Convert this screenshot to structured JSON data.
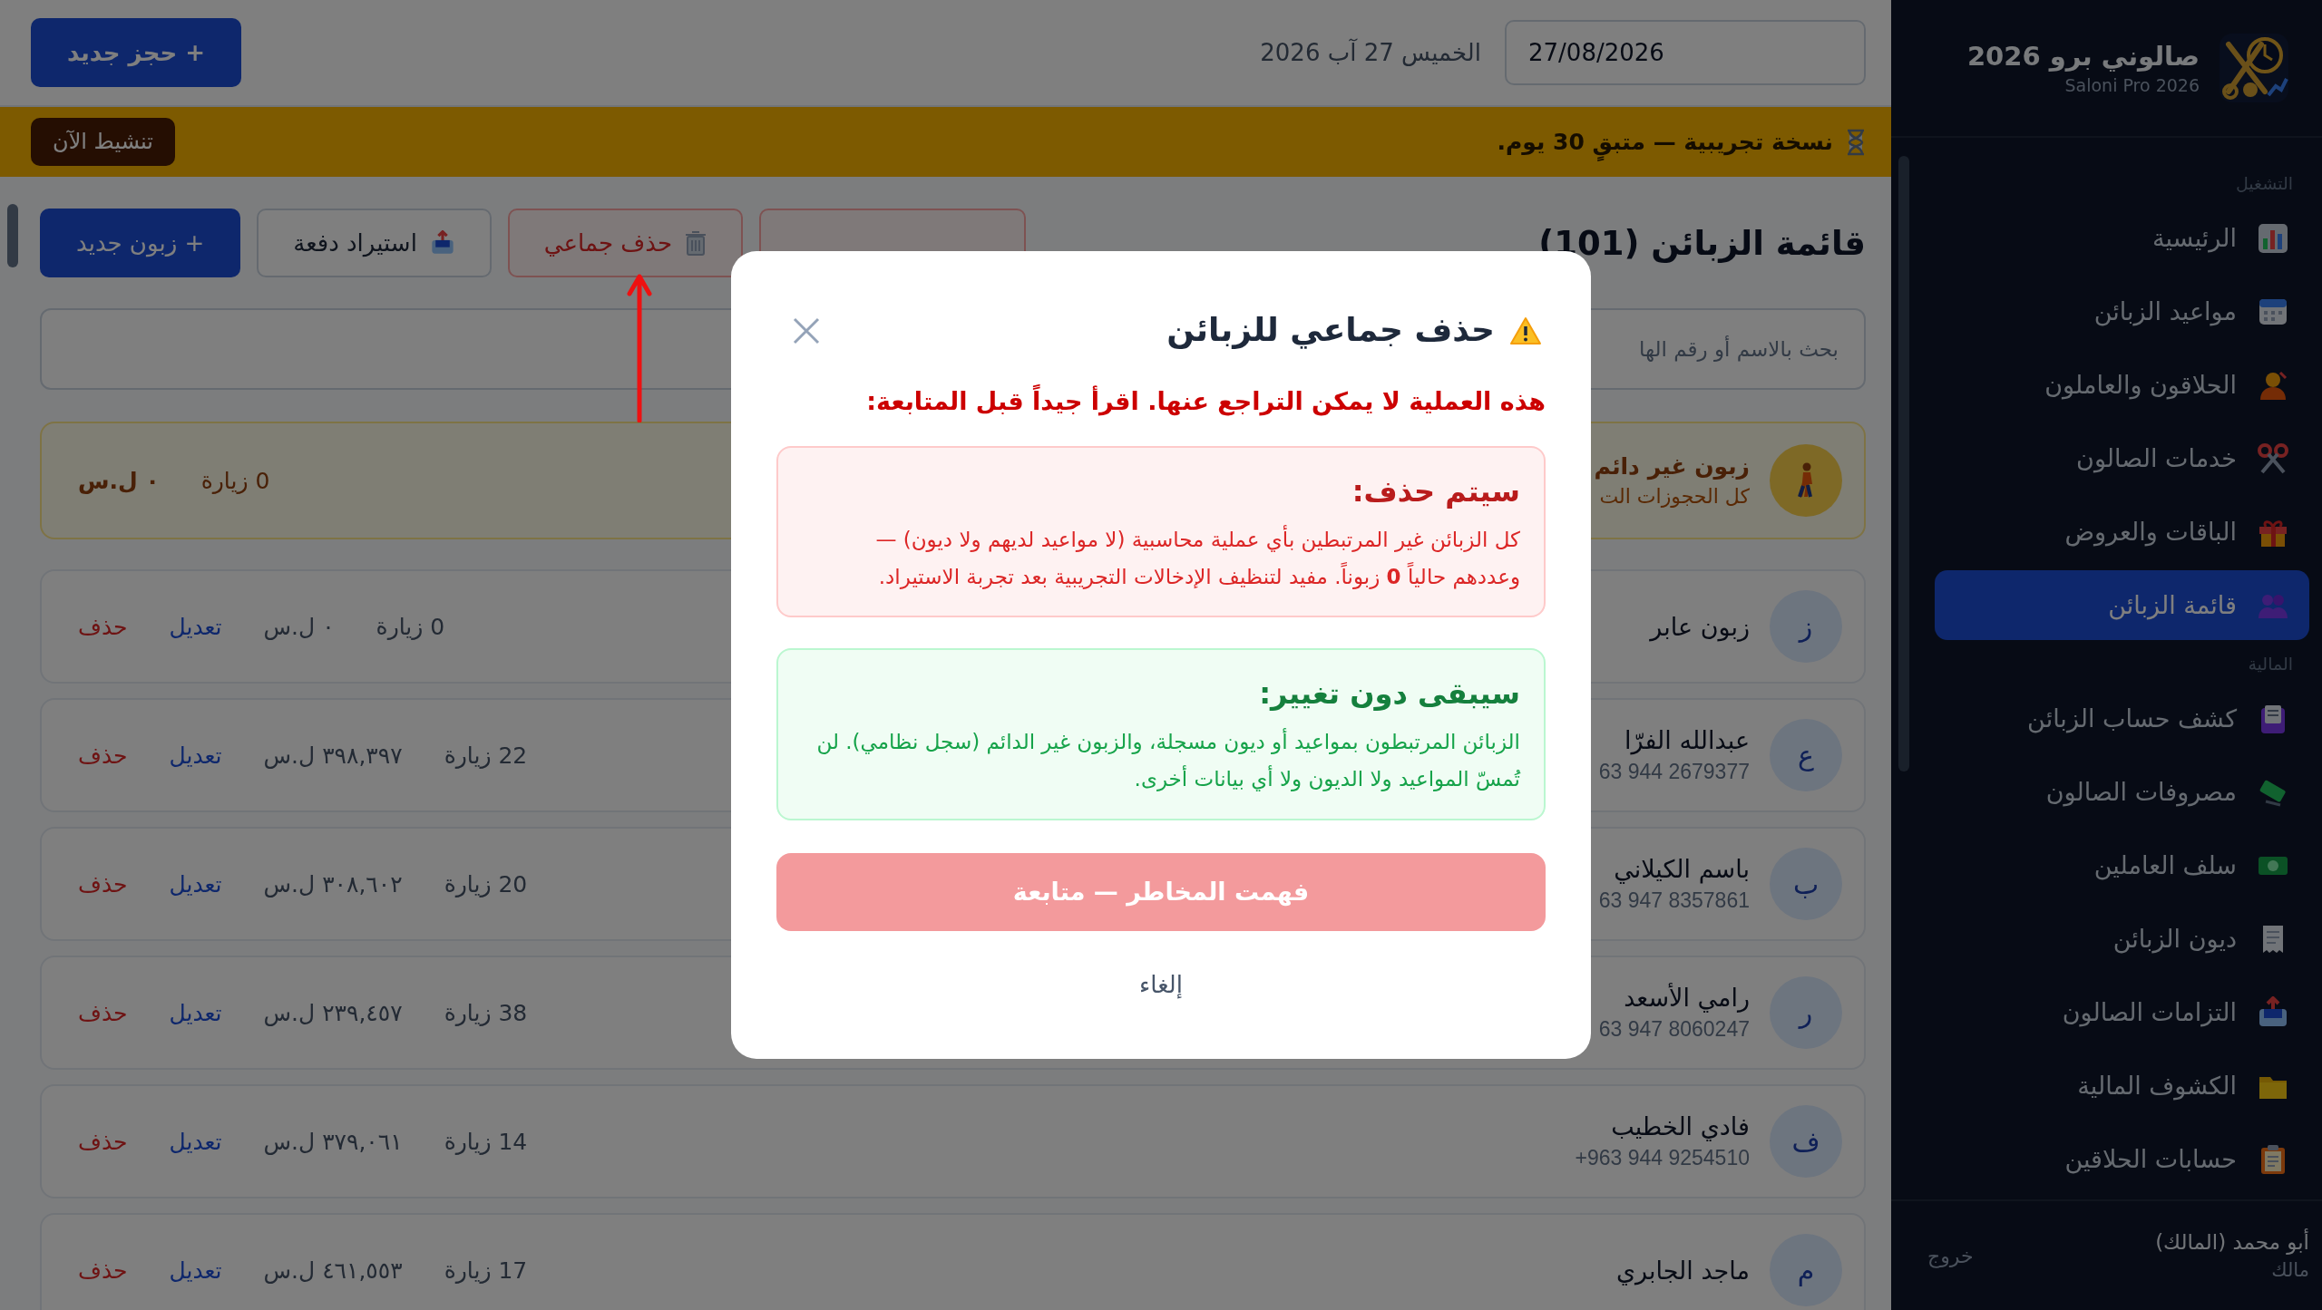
{
  "header": {
    "date_field": {
      "value": "27/08/2026"
    },
    "date_text": "الخميس 27 آب 2026",
    "new_booking_button": "+ حجز جديد"
  },
  "trial_banner": {
    "message": "نسخة تجريبية — متبقٍ 30 يوم.",
    "activate_button": "تنشيط الآن"
  },
  "page": {
    "title": "قائمة الزبائن (101)",
    "toolbar": [
      {
        "kind": "hidden"
      },
      {
        "kind": "danger",
        "label": "حذف جماعي"
      },
      {
        "kind": "import",
        "label": "استيراد دفعة"
      },
      {
        "kind": "primary",
        "label": "+ زبون جديد"
      }
    ],
    "search": {
      "placeholder": "بحث بالاسم أو رقم الها"
    },
    "walk_in": {
      "name": "زبون غير دائم",
      "note": "كل الحجوزات الت",
      "visits": "0 زيارة",
      "balance": "٠ ل.س"
    },
    "customers": [
      {
        "initial": "ز",
        "name": "زبون عابر",
        "visits": "0 زيارة",
        "balance": "٠ ل.س",
        "edit": "تعديل",
        "delete": "حذف"
      },
      {
        "initial": "ع",
        "name": "عبدالله الفرّا",
        "phone": "63 944 2679377",
        "visits": "22 زيارة",
        "balance": "٣٩٨,٣٩٧ ل.س",
        "edit": "تعديل",
        "delete": "حذف"
      },
      {
        "initial": "ب",
        "name": "باسم الكيلاني",
        "phone": "63 947 8357861",
        "visits": "20 زيارة",
        "balance": "٣٠٨,٦٠٢ ل.س",
        "edit": "تعديل",
        "delete": "حذف"
      },
      {
        "initial": "ر",
        "name": "رامي الأسعد",
        "phone": "63 947 8060247",
        "visits": "38 زيارة",
        "balance": "٢٣٩,٤٥٧ ل.س",
        "edit": "تعديل",
        "delete": "حذف"
      },
      {
        "initial": "ف",
        "name": "فادي الخطيب",
        "phone": "+963 944 9254510",
        "visits": "14 زيارة",
        "balance": "٣٧٩,٠٦١ ل.س",
        "edit": "تعديل",
        "delete": "حذف"
      },
      {
        "initial": "م",
        "name": "ماجد الجابري",
        "visits": "17 زيارة",
        "balance": "٤٦١,٥٥٣ ل.س",
        "edit": "تعديل",
        "delete": "حذف"
      }
    ]
  },
  "sidebar": {
    "app_title": "صالوني برو 2026",
    "app_subtitle": "Saloni Pro 2026",
    "sections": [
      {
        "label": "التشغيل",
        "items": [
          {
            "label": "الرئيسية",
            "selected": false
          },
          {
            "label": "مواعيد الزبائن",
            "selected": false
          },
          {
            "label": "الحلاقون والعاملون",
            "selected": false
          },
          {
            "label": "خدمات الصالون",
            "selected": false
          },
          {
            "label": "الباقات والعروض",
            "selected": false
          },
          {
            "label": "قائمة الزبائن",
            "selected": true
          }
        ]
      },
      {
        "label": "المالية",
        "items": [
          {
            "label": "كشف حساب الزبائن",
            "selected": false
          },
          {
            "label": "مصروفات الصالون",
            "selected": false
          },
          {
            "label": "سلف العاملين",
            "selected": false
          },
          {
            "label": "ديون الزبائن",
            "selected": false
          },
          {
            "label": "التزامات الصالون",
            "selected": false
          },
          {
            "label": "الكشوف المالية",
            "selected": false
          },
          {
            "label": "حسابات الحلاقين",
            "selected": false
          }
        ]
      }
    ],
    "user": {
      "name": "أبو محمد (المالك)",
      "role": "مالك"
    },
    "logout": "خروج"
  },
  "modal": {
    "title": "حذف جماعي للزبائن",
    "warning": "هذه العملية لا يمكن التراجع عنها. اقرأ جيداً قبل المتابعة:",
    "sections": [
      {
        "kind": "danger",
        "heading": "سيتم حذف:",
        "text": "كل الزبائن غير المرتبطين بأي عملية محاسبية (لا مواعيد لديهم ولا ديون) — وعددهم حالياً **0** زبوناً. مفيد لتنظيف الإدخالات التجريبية بعد تجربة الاستيراد."
      },
      {
        "kind": "safe",
        "heading": "سيبقى دون تغيير:",
        "text": "الزبائن المرتبطون بمواعيد أو ديون مسجلة، والزبون غير الدائم (سجل نظامي). لن تُمسّ المواعيد ولا الديون ولا أي بيانات أخرى."
      }
    ],
    "confirm_button": {
      "label": "فهمت المخاطر — متابعة",
      "disabled": true
    },
    "cancel": "إلغاء"
  }
}
